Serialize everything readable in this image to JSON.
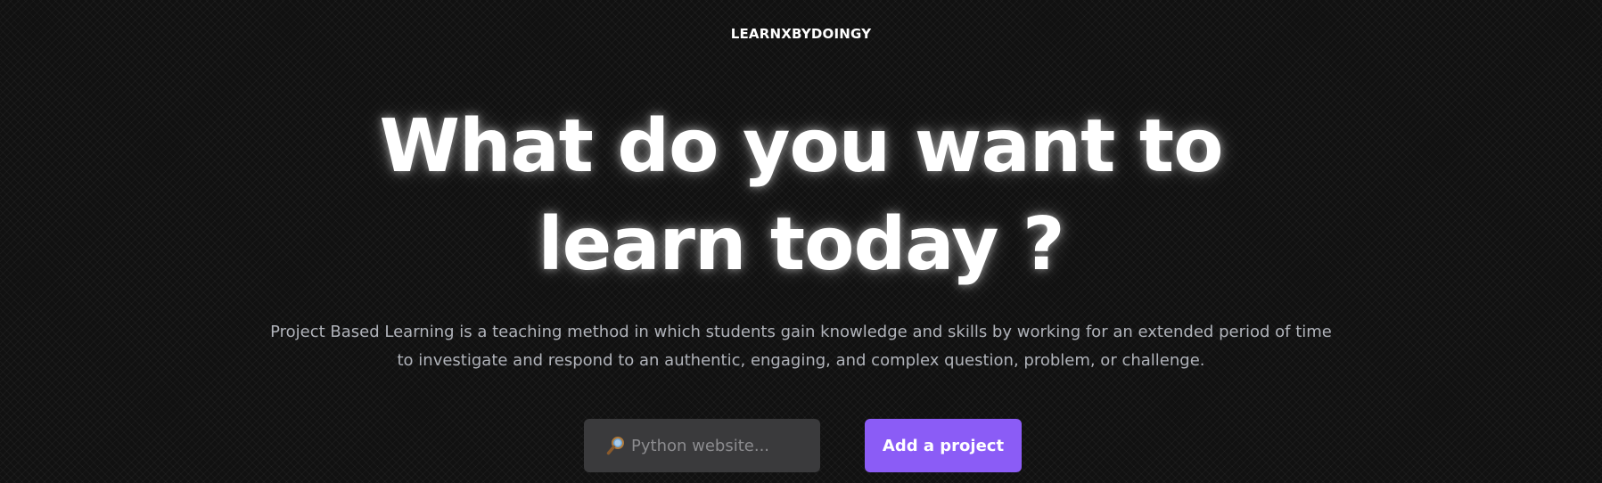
{
  "header": {
    "brand": "LEARNXBYDOINGY"
  },
  "hero": {
    "title_line1": "What do you want to",
    "title_line2": "learn today ?",
    "description": "Project Based Learning is a teaching method in which students gain knowledge and skills by working for an extended period of time to investigate and respond to an authentic, engaging, and complex question, problem, or challenge."
  },
  "search": {
    "icon": "magnifying-glass-icon",
    "placeholder": "Python website..."
  },
  "actions": {
    "add_project_label": "Add a project"
  },
  "colors": {
    "background": "#111111",
    "accent": "#8b5cf6",
    "input_background": "#3a3a3c",
    "description_text": "#b0b3ba"
  }
}
